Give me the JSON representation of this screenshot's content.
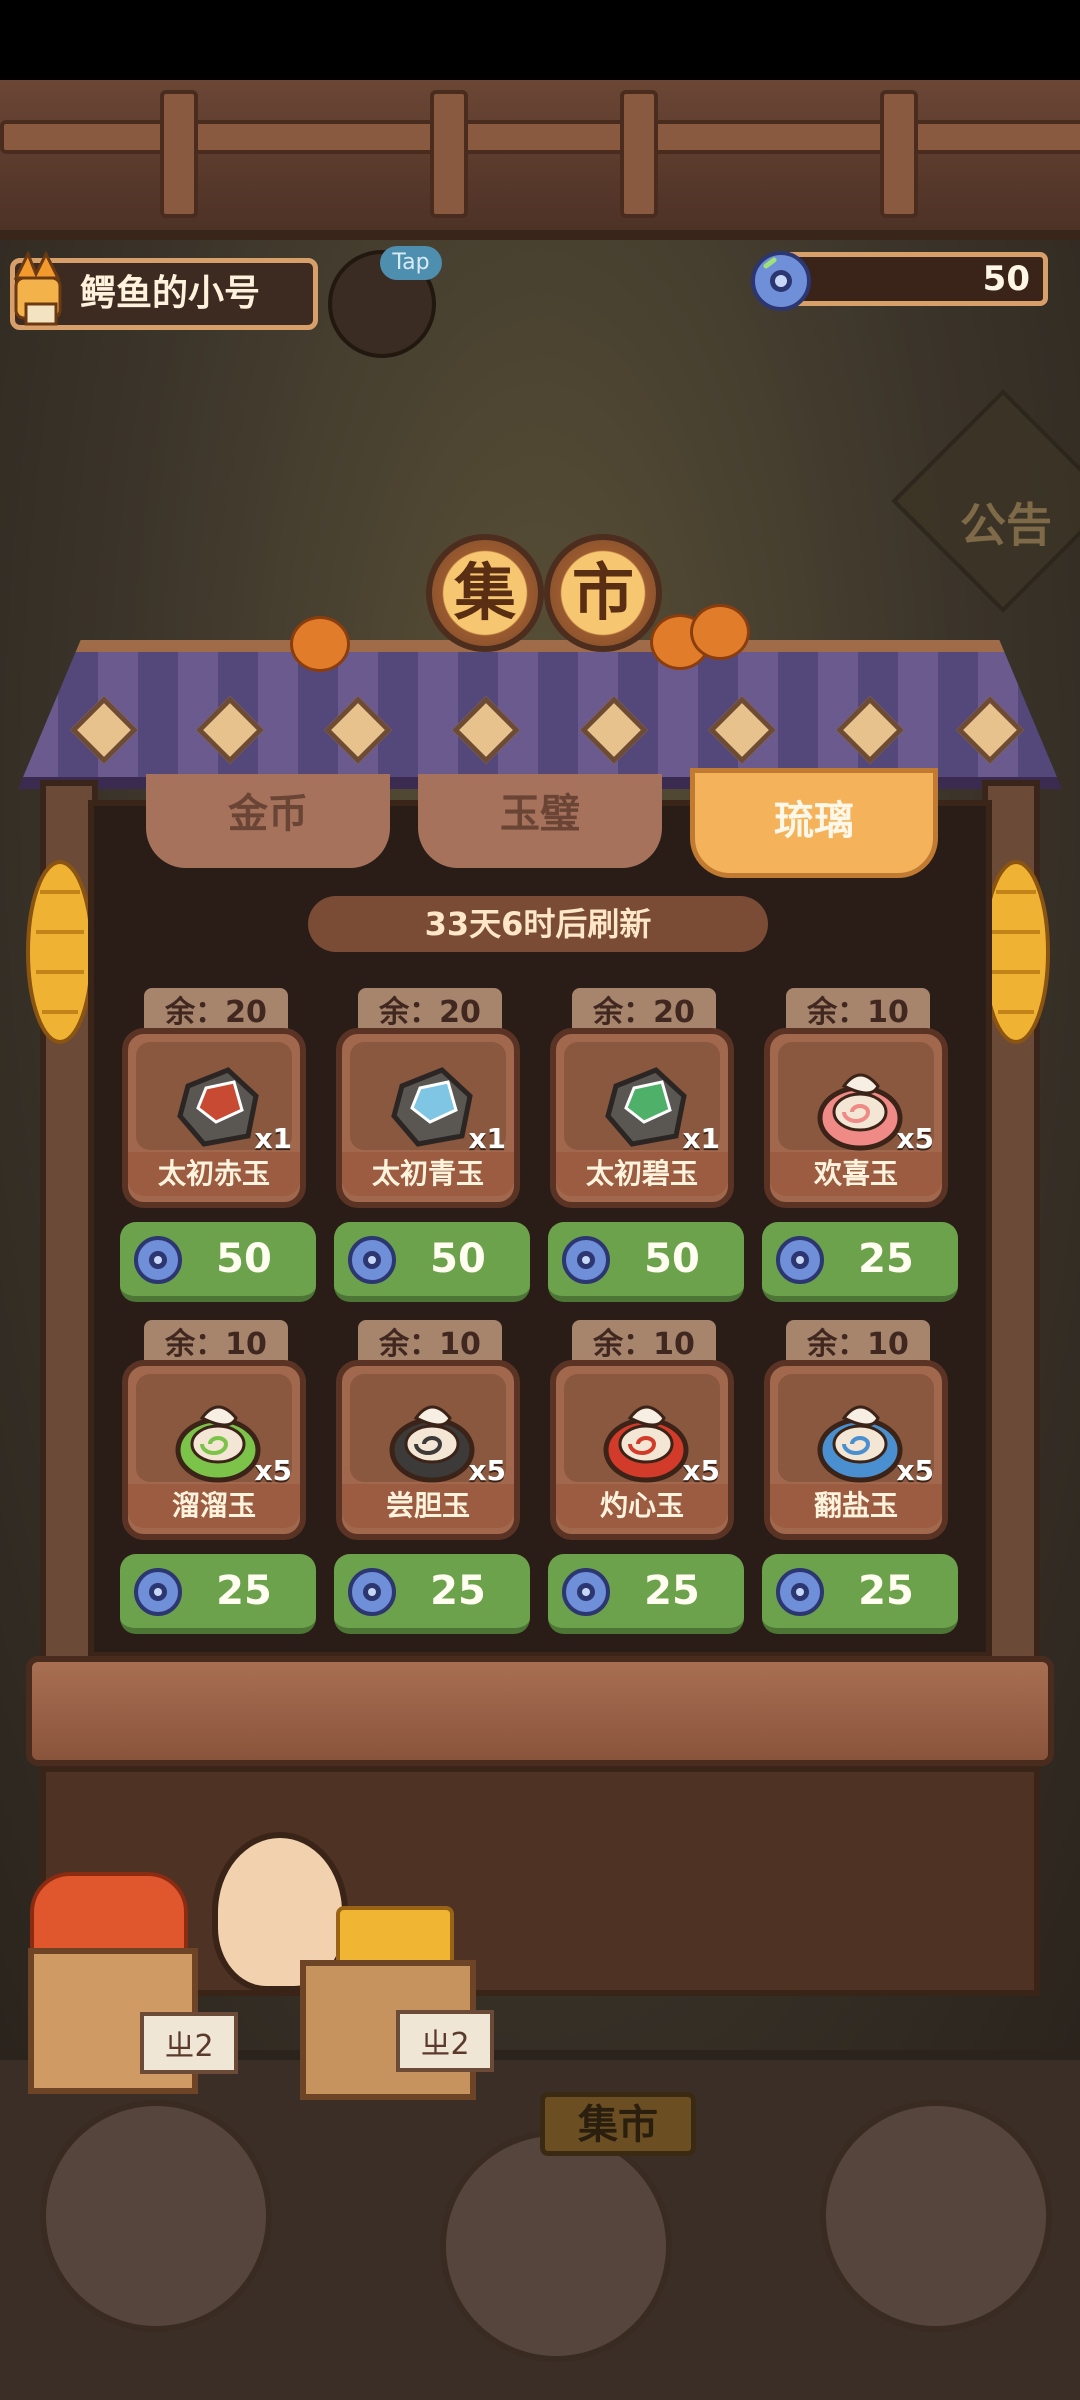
{
  "player": {
    "name": "鳄鱼的小号",
    "tap_label": "Tap"
  },
  "currency": {
    "icon": "glass-orb-icon",
    "value": "50"
  },
  "notice": {
    "label": "公告"
  },
  "market": {
    "title_chars": [
      "集",
      "市"
    ],
    "tabs": [
      {
        "label": "金币",
        "active": false
      },
      {
        "label": "玉璧",
        "active": false
      },
      {
        "label": "琉璃",
        "active": true
      }
    ],
    "refresh_text": "33天6时后刷新",
    "items": [
      {
        "stock": "余：20",
        "name": "太初赤玉",
        "qty": "x1",
        "price": "50",
        "icon": "red-stone-icon",
        "color": "#c84a32"
      },
      {
        "stock": "余：20",
        "name": "太初青玉",
        "qty": "x1",
        "price": "50",
        "icon": "blue-crystal-stone-icon",
        "color": "#7ec6e4"
      },
      {
        "stock": "余：20",
        "name": "太初碧玉",
        "qty": "x1",
        "price": "50",
        "icon": "green-jade-stone-icon",
        "color": "#4fb06a"
      },
      {
        "stock": "余：10",
        "name": "欢喜玉",
        "qty": "x5",
        "price": "25",
        "icon": "pink-spiral-jade-icon",
        "color": "#f08a86"
      },
      {
        "stock": "余：10",
        "name": "溜溜玉",
        "qty": "x5",
        "price": "25",
        "icon": "green-spiral-jade-icon",
        "color": "#7cc34a"
      },
      {
        "stock": "余：10",
        "name": "尝胆玉",
        "qty": "x5",
        "price": "25",
        "icon": "black-spiral-jade-icon",
        "color": "#3d3a3a"
      },
      {
        "stock": "余：10",
        "name": "灼心玉",
        "qty": "x5",
        "price": "25",
        "icon": "red-spiral-jade-icon",
        "color": "#d23b2a"
      },
      {
        "stock": "余：10",
        "name": "翻盐玉",
        "qty": "x5",
        "price": "25",
        "icon": "blue-spiral-jade-icon",
        "color": "#4a90d0"
      }
    ]
  },
  "stall": {
    "sign_left": "ㄓ2",
    "sign_right": "ㄓ2"
  },
  "bottom_nav": {
    "market_label": "集市"
  },
  "colors": {
    "buy_button": "#6da24c",
    "active_tab": "#f4b25a",
    "roof": "#6a5a8e"
  }
}
